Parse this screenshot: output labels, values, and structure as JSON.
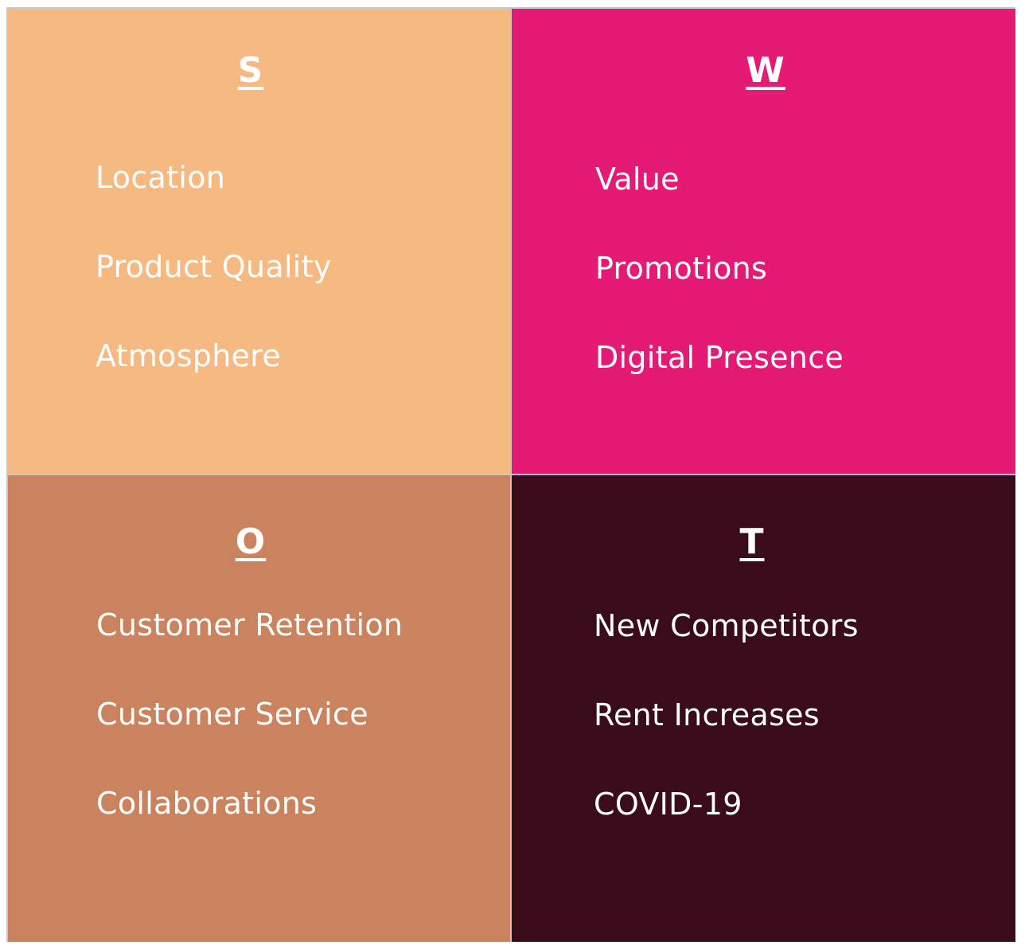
{
  "colors": {
    "strengths_bg": "#F7B982",
    "weaknesses_bg": "#E51A74",
    "opportunities_bg": "#CA835E",
    "threats_bg": "#3A0B1A",
    "text": "#FFFFFF",
    "border": "#C8C8C8"
  },
  "quadrants": [
    {
      "title": "S",
      "items": [
        "Location",
        "Product Quality",
        "Atmosphere"
      ]
    },
    {
      "title": "W",
      "items": [
        "Value",
        "Promotions",
        "Digital Presence"
      ]
    },
    {
      "title": "O",
      "items": [
        "Customer Retention",
        "Customer Service",
        "Collaborations"
      ]
    },
    {
      "title": "T",
      "items": [
        "New Competitors",
        "Rent Increases",
        "COVID-19"
      ]
    }
  ]
}
